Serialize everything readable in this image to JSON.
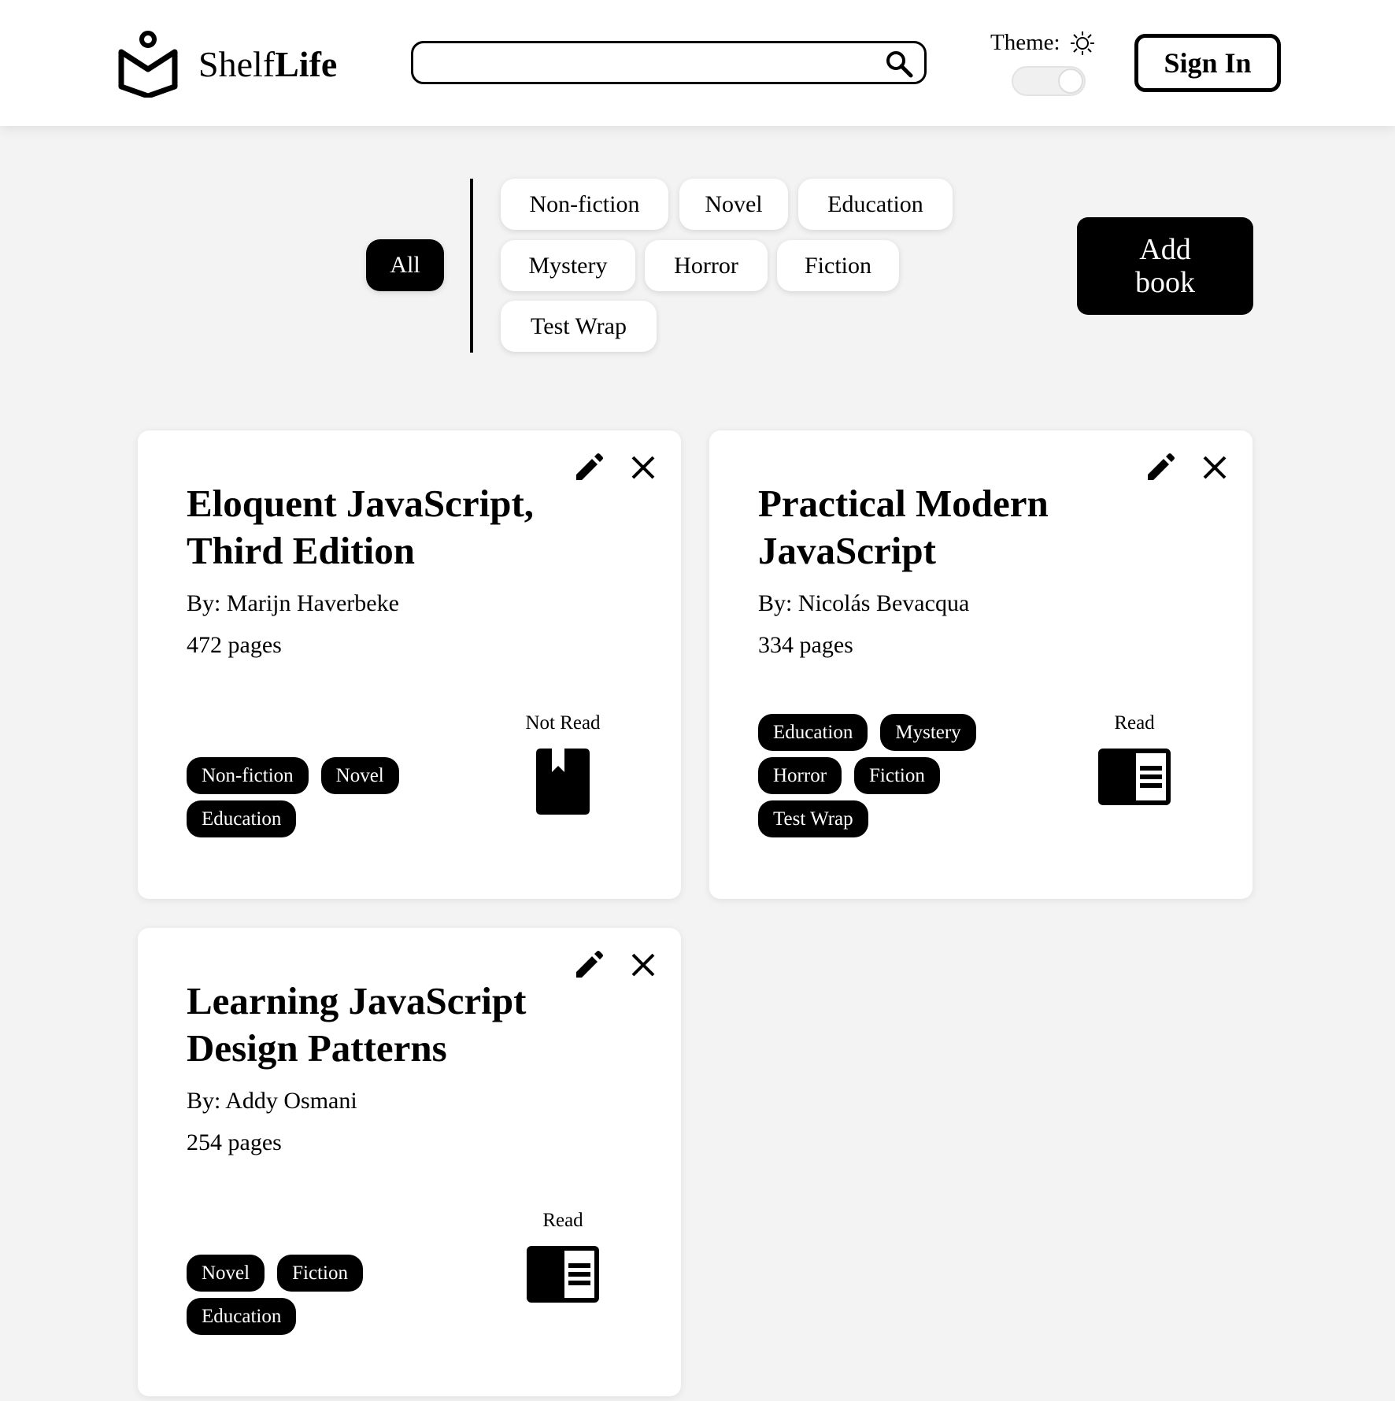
{
  "app": {
    "name_regular": "Shelf",
    "name_bold": "Life"
  },
  "search": {
    "value": "",
    "placeholder": ""
  },
  "theme": {
    "label": "Theme:",
    "mode": "light"
  },
  "header": {
    "sign_in": "Sign In"
  },
  "filters": {
    "all": "All",
    "categories": [
      "Non-fiction",
      "Novel",
      "Education",
      "Mystery",
      "Horror",
      "Fiction",
      "Test Wrap"
    ],
    "active": "All"
  },
  "add_book": {
    "line1": "Add",
    "line2": "book"
  },
  "books": [
    {
      "title": "Eloquent JavaScript, Third Edition",
      "author": "By: Marijn Haverbeke",
      "pages": "472 pages",
      "tags": [
        "Non-fiction",
        "Novel",
        "Education"
      ],
      "status": "Not Read",
      "status_icon": "bookmark-icon"
    },
    {
      "title": "Practical Modern JavaScript",
      "author": "By: Nicolás Bevacqua",
      "pages": "334 pages",
      "tags": [
        "Education",
        "Mystery",
        "Horror",
        "Fiction",
        "Test Wrap"
      ],
      "status": "Read",
      "status_icon": "open-book-icon"
    },
    {
      "title": "Learning JavaScript Design Patterns",
      "author": "By: Addy Osmani",
      "pages": "254 pages",
      "tags": [
        "Novel",
        "Fiction",
        "Education"
      ],
      "status": "Read",
      "status_icon": "open-book-icon"
    }
  ]
}
